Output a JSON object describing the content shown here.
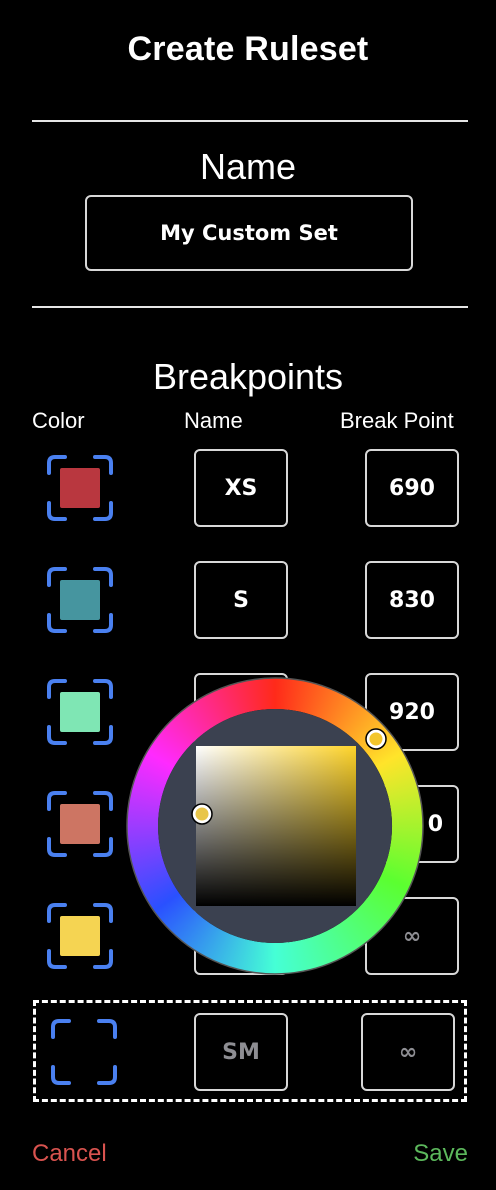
{
  "header": {
    "title": "Create Ruleset"
  },
  "name_section": {
    "heading": "Name",
    "value": "My Custom Set"
  },
  "breakpoints_section": {
    "heading": "Breakpoints",
    "columns": {
      "color": "Color",
      "name": "Name",
      "break_point": "Break Point"
    },
    "rows": [
      {
        "color": "#b9373f",
        "name": "XS",
        "break_point": "690"
      },
      {
        "color": "#46959f",
        "name": "S",
        "break_point": "830"
      },
      {
        "color": "#7fe6b4",
        "name": "",
        "break_point": "920"
      },
      {
        "color": "#cd7563",
        "name": "",
        "break_point": "0"
      },
      {
        "color": "#f5d452",
        "name": "",
        "break_point": "∞"
      }
    ],
    "new_row": {
      "name_placeholder": "SM",
      "break_point_placeholder": "∞"
    }
  },
  "color_picker": {
    "open": true
  },
  "footer": {
    "cancel_label": "Cancel",
    "save_label": "Save"
  },
  "colors": {
    "accent_blue": "#4a80f0",
    "cancel": "#d9534f",
    "save": "#5cb85c"
  }
}
